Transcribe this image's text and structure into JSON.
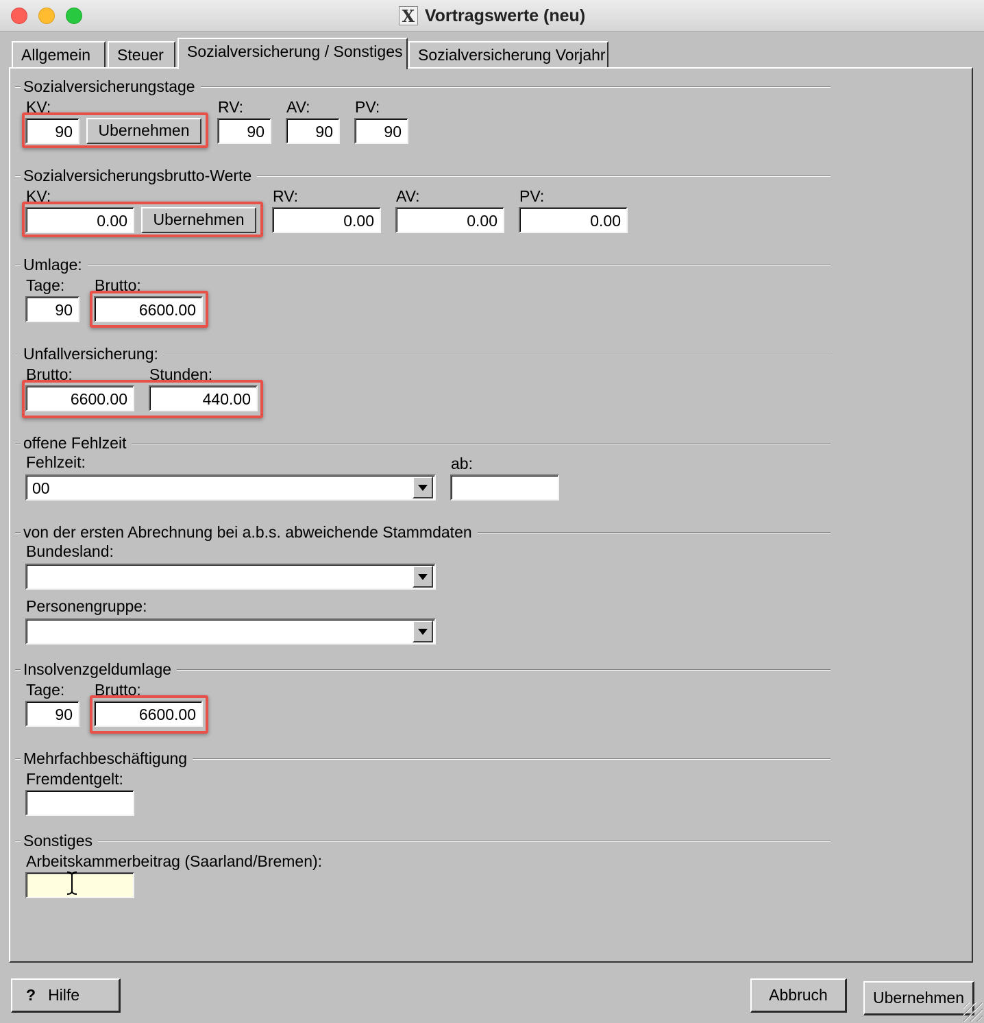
{
  "window": {
    "title": "Vortragswerte (neu)",
    "logo": "X"
  },
  "tabs": [
    {
      "label": "Allgemein"
    },
    {
      "label": "Steuer"
    },
    {
      "label": "Sozialversicherung / Sonstiges",
      "active": true
    },
    {
      "label": "Sozialversicherung Vorjahr"
    }
  ],
  "svtage": {
    "title": "Sozialversicherungstage",
    "kv_label": "KV:",
    "kv_value": "90",
    "button": "Ubernehmen",
    "rv_label": "RV:",
    "rv_value": "90",
    "av_label": "AV:",
    "av_value": "90",
    "pv_label": "PV:",
    "pv_value": "90"
  },
  "svbrutto": {
    "title": "Sozialversicherungsbrutto-Werte",
    "kv_label": "KV:",
    "kv_value": "0.00",
    "button": "Ubernehmen",
    "rv_label": "RV:",
    "rv_value": "0.00",
    "av_label": "AV:",
    "av_value": "0.00",
    "pv_label": "PV:",
    "pv_value": "0.00"
  },
  "umlage": {
    "title": "Umlage:",
    "tage_label": "Tage:",
    "tage_value": "90",
    "brutto_label": "Brutto:",
    "brutto_value": "6600.00"
  },
  "unfall": {
    "title": "Unfallversicherung:",
    "brutto_label": "Brutto:",
    "brutto_value": "6600.00",
    "stunden_label": "Stunden:",
    "stunden_value": "440.00"
  },
  "fehlzeit": {
    "title": "offene Fehlzeit",
    "fehlzeit_label": "Fehlzeit:",
    "fehlzeit_value": "00",
    "ab_label": "ab:",
    "ab_value": ""
  },
  "stammdaten": {
    "title": "von der ersten Abrechnung bei a.b.s. abweichende Stammdaten",
    "bundesland_label": "Bundesland:",
    "bundesland_value": "",
    "personengruppe_label": "Personengruppe:",
    "personengruppe_value": ""
  },
  "insolvenz": {
    "title": "Insolvenzgeldumlage",
    "tage_label": "Tage:",
    "tage_value": "90",
    "brutto_label": "Brutto:",
    "brutto_value": "6600.00"
  },
  "mehrfach": {
    "title": "Mehrfachbeschäftigung",
    "fremd_label": "Fremdentgelt:",
    "fremd_value": ""
  },
  "sonstiges": {
    "title": "Sonstiges",
    "ak_label": "Arbeitskammerbeitrag (Saarland/Bremen):",
    "ak_value": ""
  },
  "footer": {
    "help_icon": "?",
    "help_label": "Hilfe",
    "cancel_label": "Abbruch",
    "ok_label": "Ubernehmen"
  },
  "colors": {
    "highlight": "#e8504a",
    "background": "#c0c0c0",
    "active_field": "#ffffe0"
  }
}
